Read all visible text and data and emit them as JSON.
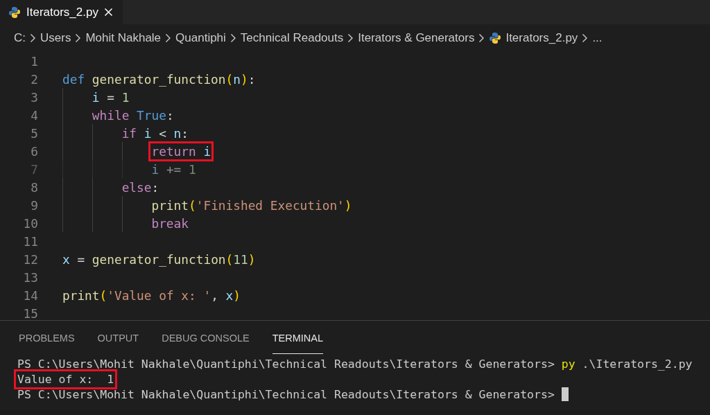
{
  "tabs": [
    {
      "label": "Iterators_2.py",
      "selected": true
    }
  ],
  "breadcrumb": [
    {
      "label": "C:",
      "kind": "folder"
    },
    {
      "label": "Users",
      "kind": "folder"
    },
    {
      "label": "Mohit Nakhale",
      "kind": "folder"
    },
    {
      "label": "Quantiphi",
      "kind": "folder"
    },
    {
      "label": "Technical Readouts",
      "kind": "folder"
    },
    {
      "label": "Iterators & Generators",
      "kind": "folder"
    },
    {
      "label": "Iterators_2.py",
      "kind": "file"
    },
    {
      "label": "...",
      "kind": "more"
    }
  ],
  "code_lines": [
    {
      "number": "1",
      "dimmed": false
    },
    {
      "number": "2",
      "dimmed": false,
      "tokens": [
        {
          "text": "def",
          "kind": "keyword"
        },
        {
          "text": " generator_function",
          "kind": "function"
        },
        {
          "text": "(",
          "kind": "paren"
        },
        {
          "text": "n",
          "kind": "variable"
        },
        {
          "text": ")",
          "kind": "paren"
        },
        {
          "text": ":",
          "kind": "punct"
        }
      ]
    },
    {
      "number": "3",
      "dimmed": false,
      "tokens": [
        {
          "text": "    i",
          "kind": "variable"
        },
        {
          "text": " =",
          "kind": "punct"
        },
        {
          "text": " 1",
          "kind": "number"
        }
      ]
    },
    {
      "number": "4",
      "dimmed": false,
      "tokens": [
        {
          "text": "    while",
          "kind": "control"
        },
        {
          "text": " True",
          "kind": "keyword"
        },
        {
          "text": ":",
          "kind": "punct"
        }
      ]
    },
    {
      "number": "5",
      "dimmed": false,
      "tokens": [
        {
          "text": "        if",
          "kind": "control"
        },
        {
          "text": " i",
          "kind": "variable"
        },
        {
          "text": " <",
          "kind": "punct"
        },
        {
          "text": " n",
          "kind": "variable"
        },
        {
          "text": ":",
          "kind": "punct"
        }
      ]
    },
    {
      "number": "6",
      "dimmed": false,
      "tokens": [
        {
          "kind": "boxed",
          "tokens": [
            {
              "text": "            return",
              "kind": "control"
            },
            {
              "text": " i",
              "kind": "variable"
            }
          ]
        }
      ]
    },
    {
      "number": "7",
      "dimmed": true,
      "tokens": [
        {
          "text": "            i",
          "kind": "variable"
        },
        {
          "text": " +=",
          "kind": "punct"
        },
        {
          "text": " 1",
          "kind": "number"
        }
      ]
    },
    {
      "number": "8",
      "dimmed": false,
      "tokens": [
        {
          "text": "        else",
          "kind": "control"
        },
        {
          "text": ":",
          "kind": "punct"
        }
      ]
    },
    {
      "number": "9",
      "dimmed": false,
      "tokens": [
        {
          "text": "            print",
          "kind": "function"
        },
        {
          "text": "(",
          "kind": "paren"
        },
        {
          "text": "'Finished Execution'",
          "kind": "string"
        },
        {
          "text": ")",
          "kind": "paren"
        }
      ]
    },
    {
      "number": "10",
      "dimmed": false,
      "tokens": [
        {
          "text": "            break",
          "kind": "control"
        }
      ]
    },
    {
      "number": "11",
      "dimmed": false
    },
    {
      "number": "12",
      "dimmed": false,
      "tokens": [
        {
          "text": "x",
          "kind": "variable"
        },
        {
          "text": " =",
          "kind": "punct"
        },
        {
          "text": " generator_function",
          "kind": "function"
        },
        {
          "text": "(",
          "kind": "paren"
        },
        {
          "text": "11",
          "kind": "number"
        },
        {
          "text": ")",
          "kind": "paren"
        }
      ]
    },
    {
      "number": "13",
      "dimmed": false
    },
    {
      "number": "14",
      "dimmed": false,
      "tokens": [
        {
          "text": "print",
          "kind": "function"
        },
        {
          "text": "(",
          "kind": "paren"
        },
        {
          "text": "'Value of x: '",
          "kind": "string"
        },
        {
          "text": ",",
          "kind": "punct"
        },
        {
          "text": " x",
          "kind": "variable"
        },
        {
          "text": ")",
          "kind": "paren"
        }
      ]
    },
    {
      "number": "15",
      "dimmed": false
    }
  ],
  "panel_tabs": [
    {
      "label": "PROBLEMS",
      "selected": false
    },
    {
      "label": "OUTPUT",
      "selected": false
    },
    {
      "label": "DEBUG CONSOLE",
      "selected": false
    },
    {
      "label": "TERMINAL",
      "selected": true
    }
  ],
  "terminal_lines": [
    {
      "boxed": false,
      "cursor": false,
      "segments": [
        {
          "text": "PS C:\\Users\\Mohit Nakhale\\Quantiphi\\Technical Readouts\\Iterators & Generators>",
          "kind": "prompt"
        },
        {
          "text": " py",
          "kind": "command"
        },
        {
          "text": " .\\Iterators_2.py",
          "kind": "argument"
        }
      ]
    },
    {
      "boxed": true,
      "cursor": false,
      "segments": [
        {
          "text": "Value of x:  1",
          "kind": "output"
        }
      ]
    },
    {
      "boxed": false,
      "cursor": true,
      "segments": [
        {
          "text": "PS C:\\Users\\Mohit Nakhale\\Quantiphi\\Technical Readouts\\Iterators & Generators>",
          "kind": "prompt"
        }
      ]
    }
  ]
}
